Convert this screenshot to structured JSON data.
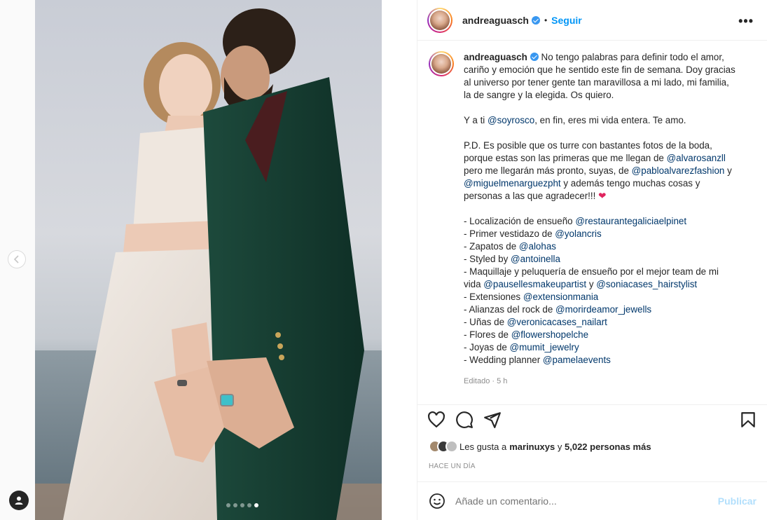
{
  "post": {
    "username": "andreaguasch",
    "follow_label": "Seguir",
    "separator": "•",
    "more_label": "•••",
    "carousel": {
      "total": 5,
      "active_index": 4
    }
  },
  "caption": {
    "lines": [
      {
        "t": "u",
        "text": "andreaguasch"
      },
      {
        "t": "p",
        "text": " No tengo palabras para definir todo el amor,"
      }
    ],
    "first_line_rest": "No tengo palabras para definir todo el amor,",
    "l2": "cariño y emoción que he sentido este fin de semana. Doy gracias",
    "l3": "al universo por tener gente tan maravillosa a mi lado, mi familia,",
    "l4": "la de sangre y la elegida. Os quiero.",
    "p2_pre": "Y a ti ",
    "p2_mention": "@soyrosco",
    "p2_post": ", en fin, eres mi vida entera. Te amo.",
    "p3_l1": "P.D. Es posible que os turre con bastantes fotos de la boda,",
    "p3_l2_pre": "porque estas son las primeras que me llegan de ",
    "p3_l2_mention": "@alvarosanzll",
    "p3_l3_pre": "pero me llegarán más pronto, suyas, de ",
    "p3_l3_mention": "@pabloalvarezfashion",
    "p3_l3_post": " y",
    "p3_l4_mention": "@miguelmenarguezpht",
    "p3_l4_post": " y además tengo muchas cosas y",
    "p3_l5": "personas a las que agradecer!!! ",
    "heart": "❤",
    "list": [
      {
        "pre": "- Localización de ensueño ",
        "mention": "@restaurantegaliciaelpinet"
      },
      {
        "pre": "- Primer vestidazo de ",
        "mention": "@yolancris"
      },
      {
        "pre": "- Zapatos de ",
        "mention": "@alohas"
      },
      {
        "pre": "- Styled by ",
        "mention": "@antoinella"
      },
      {
        "pre": "- Maquillaje y peluquería de ensueño por el mejor team de mi",
        "mention": ""
      }
    ],
    "vida_pre": "vida ",
    "vida_m1": "@pausellesmakeupartist",
    "vida_and": " y ",
    "vida_m2": "@soniacases_hairstylist",
    "list2": [
      {
        "pre": "- Extensiones ",
        "mention": "@extensionmania"
      },
      {
        "pre": "- Alianzas del rock de ",
        "mention": "@morirdeamor_jewells"
      },
      {
        "pre": "- Uñas de ",
        "mention": "@veronicacases_nailart"
      },
      {
        "pre": "- Flores de ",
        "mention": "@flowershopelche"
      },
      {
        "pre": "- Joyas de ",
        "mention": "@mumit_jewelry"
      },
      {
        "pre": "- Wedding planner ",
        "mention": "@pamelaevents"
      }
    ],
    "edited": "Editado · 5 h"
  },
  "likes": {
    "prefix": "Les gusta a ",
    "user": "marinuxys",
    "middle": " y ",
    "count": "5,022 personas más"
  },
  "timeago": "HACE UN DÍA",
  "comment": {
    "placeholder": "Añade un comentario...",
    "publish": "Publicar"
  },
  "icons": [
    "chevron-left-icon",
    "user-icon",
    "verified-icon",
    "heart-icon",
    "comment-icon",
    "share-icon",
    "bookmark-icon",
    "emoji-icon"
  ]
}
